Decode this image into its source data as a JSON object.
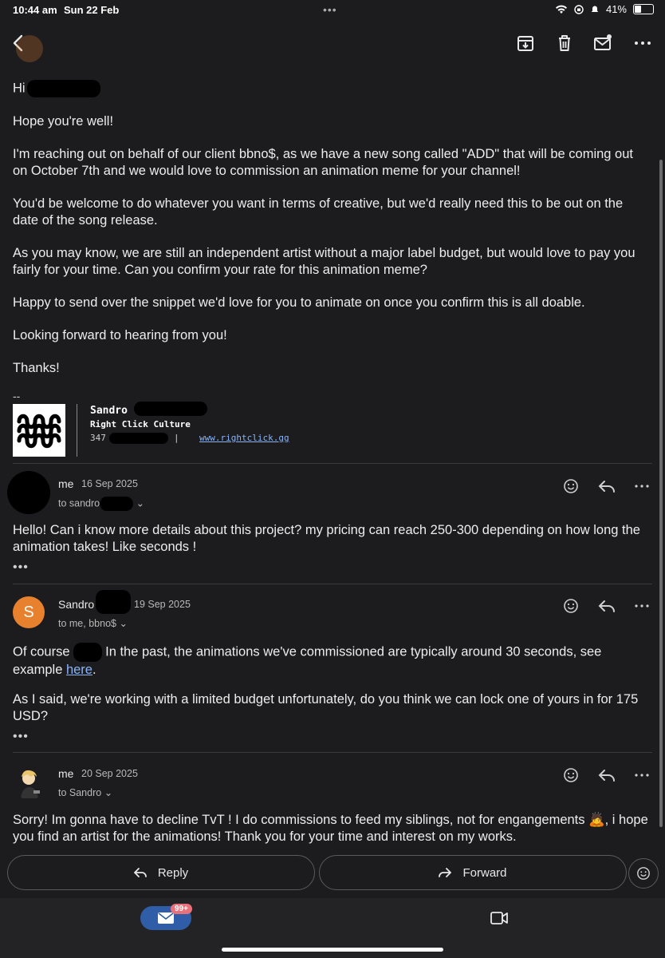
{
  "status_bar": {
    "time": "10:44 am",
    "date": "Sun 22 Feb",
    "battery": "41%",
    "battery_level": 0.41
  },
  "toolbar": {
    "icons": [
      "back-arrow-icon",
      "archive-icon",
      "trash-icon",
      "mark-unread-icon",
      "more-options-icon"
    ]
  },
  "first_email": {
    "greeting": "Hi",
    "paragraphs": [
      "Hope you're well!",
      "I'm reaching out on behalf of our client bbno$, as we have a new song called \"ADD\" that will be coming out on October 7th and we would love to commission an animation meme for your channel!",
      "You'd be welcome to do whatever you want in terms of creative, but we'd really need this to be out on the date of the song release.",
      "As you may know, we are still an independent artist without a major label budget, but would love to pay you fairly for your time. Can you confirm your rate for this animation meme?",
      "Happy to send over the snippet we'd love for you to animate on once you confirm this is all doable.",
      "Looking forward to hearing from you!",
      "Thanks!"
    ],
    "signature": {
      "separator": "--",
      "name": "Sandro",
      "company": "Right Click Culture",
      "phone": "347",
      "divider": "|",
      "website": "www.rightclick.gg"
    }
  },
  "messages": [
    {
      "sender": "me",
      "date": "16 Sep 2025",
      "to": "to sandro",
      "body": "Hello! Can i know more details about this project? my pricing can reach 250-300 depending on how long the animation takes! Like seconds !",
      "more": "•••"
    },
    {
      "sender": "Sandro",
      "avatar_letter": "S",
      "date": "19 Sep 2025",
      "to": "to me, bbno$",
      "body_1a": "Of course",
      "body_1b": " In the past, the animations we've commissioned are typically around 30 seconds, see example ",
      "body_1_link": "here",
      "body_1c": ".",
      "body_2": "As I said, we're working with a limited budget unfortunately, do you think we can lock one of yours in for 175 USD?",
      "more": "•••"
    },
    {
      "sender": "me",
      "date": "20 Sep 2025",
      "to": "to Sandro",
      "body_a": "Sorry! Im gonna have to decline TvT ! I do commissions to feed my siblings, not for engangements ",
      "emoji": "🙇",
      "body_b": ", i hope you find an artist for the animations! Thank you for your time and interest on my works."
    }
  ],
  "actions": {
    "reply": "Reply",
    "forward": "Forward"
  },
  "bottom_nav": {
    "mail_badge": "99+"
  },
  "colors": {
    "background": "#1c1c1e",
    "avatar_orange": "#e8812e",
    "link_blue": "#8ab4f8",
    "mail_pill_blue": "#2f5da8",
    "badge_pink": "#e9727a"
  }
}
